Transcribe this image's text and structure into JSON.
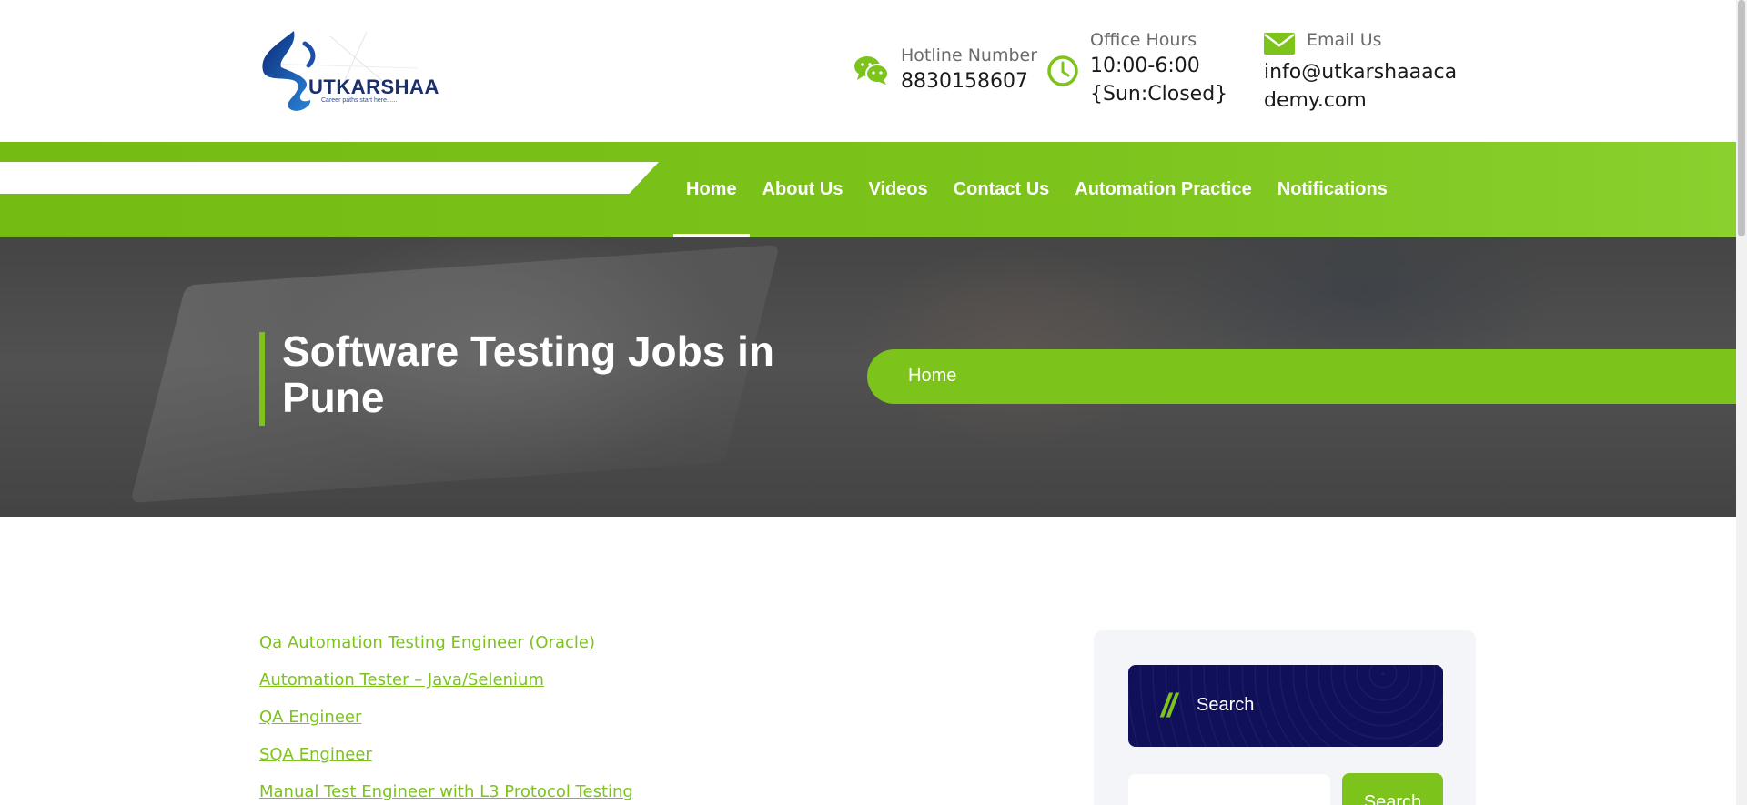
{
  "brand": {
    "name": "UTKARSHAA",
    "tagline": "Career paths start here......",
    "colors": {
      "accent": "#7cc31c",
      "navy": "#0f0f5a",
      "logo_blue": "#1b2f6b"
    }
  },
  "contact": {
    "hotline": {
      "label": "Hotline Number",
      "value": "8830158607",
      "icon": "chat-bubbles-icon"
    },
    "hours": {
      "label": "Office Hours",
      "line1": "10:00-6:00",
      "line2": "{Sun:Closed}",
      "icon": "clock-icon"
    },
    "email": {
      "label": "Email Us",
      "line1": "info@utkarshaaaca",
      "line2": "demy.com",
      "icon": "envelope-icon"
    }
  },
  "nav": {
    "items": [
      {
        "label": "Home",
        "active": true
      },
      {
        "label": "About Us",
        "active": false
      },
      {
        "label": "Videos",
        "active": false
      },
      {
        "label": "Contact Us",
        "active": false
      },
      {
        "label": "Automation Practice",
        "active": false
      },
      {
        "label": "Notifications",
        "active": false
      }
    ]
  },
  "hero": {
    "title": "Software Testing Jobs in Pune",
    "breadcrumb": "Home"
  },
  "jobs": [
    "Qa Automation Testing Engineer (Oracle)",
    "Automation Tester – Java/Selenium",
    "QA Engineer",
    "SQA Engineer",
    "Manual Test Engineer with L3 Protocol Testing"
  ],
  "sidebar": {
    "widget_title": "Search",
    "search_placeholder": "",
    "search_button": "Search"
  }
}
